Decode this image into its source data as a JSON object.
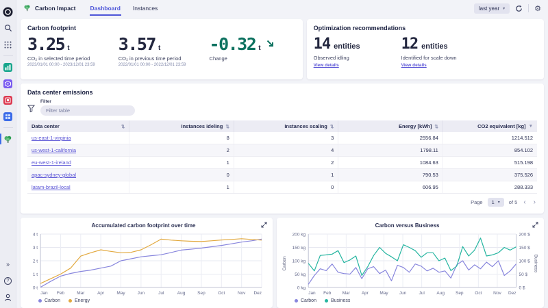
{
  "app": {
    "title": "Carbon Impact",
    "tabs": [
      {
        "label": "Dashboard",
        "active": true
      },
      {
        "label": "Instances",
        "active": false
      }
    ],
    "time_picker": "last year"
  },
  "icons": {
    "sort": "⇅",
    "sort_desc": "▼",
    "chevron_down": "▾",
    "page_prev": "‹",
    "page_next": "›",
    "collapse": "»",
    "help": "?",
    "gear": "⚙"
  },
  "colors": {
    "accent_link": "#5b55d6",
    "active_tab": "#4d55d8",
    "positive_change": "#0e7260",
    "carbon_series": "#8886dd",
    "energy_series": "#e2a93f",
    "business_series": "#25b5a0"
  },
  "carbon_footprint": {
    "heading": "Carbon footprint",
    "metrics": [
      {
        "value": "3.25",
        "unit": "t",
        "caption": "CO₂ in selected time period",
        "range": "2023/01/01 00:00 - 2023/12/01 23:59"
      },
      {
        "value": "3.57",
        "unit": "t",
        "caption": "CO₂ in previous time period",
        "range": "2022/01/01 00:00 - 2022/12/01 23:59"
      },
      {
        "value": "-0.32",
        "unit": "t",
        "caption": "Change",
        "trend": "down"
      }
    ]
  },
  "optimization": {
    "heading": "Optimization recommendations",
    "items": [
      {
        "value": "14",
        "unit": "entities",
        "caption": "Observed idling",
        "link": "View details"
      },
      {
        "value": "12",
        "unit": "entities",
        "caption": "Identified for scale down",
        "link": "View details"
      }
    ]
  },
  "emissions_table": {
    "heading": "Data center emissions",
    "filter_label": "Filter",
    "filter_placeholder": "Filter table",
    "columns": [
      "Data center",
      "Instances ideling",
      "Instances scaling",
      "Energy [kWh]",
      "CO2 equivalent [kg]"
    ],
    "sorted_column": "CO2 equivalent [kg]",
    "rows": [
      {
        "name": "us-east-1-virginia",
        "idling": "8",
        "scaling": "3",
        "energy": "2556.84",
        "co2": "1214.512"
      },
      {
        "name": "us-west-1-california",
        "idling": "2",
        "scaling": "4",
        "energy": "1798.11",
        "co2": "854.102"
      },
      {
        "name": "eu-west-1-ireland",
        "idling": "1",
        "scaling": "2",
        "energy": "1084.63",
        "co2": "515.198"
      },
      {
        "name": "apac-sydney-global",
        "idling": "0",
        "scaling": "1",
        "energy": "790.53",
        "co2": "375.526"
      },
      {
        "name": "latam-brazil-local",
        "idling": "1",
        "scaling": "0",
        "energy": "606.95",
        "co2": "288.333"
      }
    ],
    "pagination": {
      "label": "Page",
      "page": "1",
      "of": "of 5"
    }
  },
  "chart_data": [
    {
      "type": "line",
      "title": "Accumulated carbon footprint over time",
      "x_ticks": [
        "Jan",
        "Feb",
        "Mar",
        "Apr",
        "May",
        "Jun",
        "Jul",
        "Aug",
        "Sep",
        "Oct",
        "Nov",
        "Dez"
      ],
      "y_ticks": [
        "0 t",
        "1 t",
        "2 t",
        "3 t",
        "4 t"
      ],
      "ylim": [
        0,
        4
      ],
      "grid": true,
      "legend_position": "bottom-left",
      "series": [
        {
          "name": "Carbon",
          "color": "#8886dd",
          "values": [
            0.02,
            0.45,
            0.85,
            1.05,
            1.2,
            1.3,
            1.45,
            1.6,
            2.0,
            2.15,
            2.3,
            2.38,
            2.45,
            2.62,
            2.8,
            2.87,
            2.95,
            3.05,
            3.15,
            3.27,
            3.4,
            3.5,
            3.62
          ]
        },
        {
          "name": "Energy",
          "color": "#e2a93f",
          "values": [
            0.3,
            0.65,
            1.0,
            1.45,
            2.35,
            2.6,
            2.82,
            2.7,
            2.6,
            2.63,
            2.82,
            3.2,
            3.62,
            3.55,
            3.5,
            3.46,
            3.44,
            3.5,
            3.56,
            3.6,
            3.65,
            3.6,
            3.55
          ]
        }
      ]
    },
    {
      "type": "line",
      "title": "Carbon versus Business",
      "x_ticks": [
        "Jan",
        "Feb",
        "Mar",
        "Apr",
        "May",
        "Jun",
        "Jul",
        "Aug",
        "Sep",
        "Oct",
        "Nov",
        "Dez"
      ],
      "left_axis": {
        "label": "Carbon",
        "ticks": [
          "0 kg",
          "50 kg",
          "100 kg",
          "150 kg",
          "200 kg"
        ],
        "ylim": [
          0,
          200
        ]
      },
      "right_axis": {
        "label": "Business",
        "ticks": [
          "0 $",
          "50 $",
          "100 $",
          "150 $",
          "200 $"
        ],
        "ylim": [
          0,
          200
        ]
      },
      "grid": true,
      "legend_position": "bottom-left",
      "series": [
        {
          "name": "Carbon",
          "axis": "left",
          "color": "#8886dd",
          "values": [
            12,
            45,
            70,
            63,
            88,
            57,
            52,
            50,
            75,
            33,
            70,
            78,
            52,
            65,
            25,
            83,
            75,
            57,
            88,
            80,
            62,
            72,
            57,
            62,
            35,
            85,
            100,
            65,
            85,
            70,
            95,
            78,
            100,
            45,
            62,
            88
          ]
        },
        {
          "name": "Business",
          "axis": "right",
          "color": "#25b5a0",
          "values": [
            90,
            62,
            120,
            122,
            125,
            138,
            93,
            103,
            118,
            45,
            78,
            120,
            150,
            128,
            115,
            100,
            160,
            150,
            138,
            113,
            130,
            130,
            100,
            110,
            63,
            80,
            153,
            118,
            140,
            185,
            118,
            122,
            130,
            150,
            140,
            152
          ]
        }
      ]
    }
  ]
}
